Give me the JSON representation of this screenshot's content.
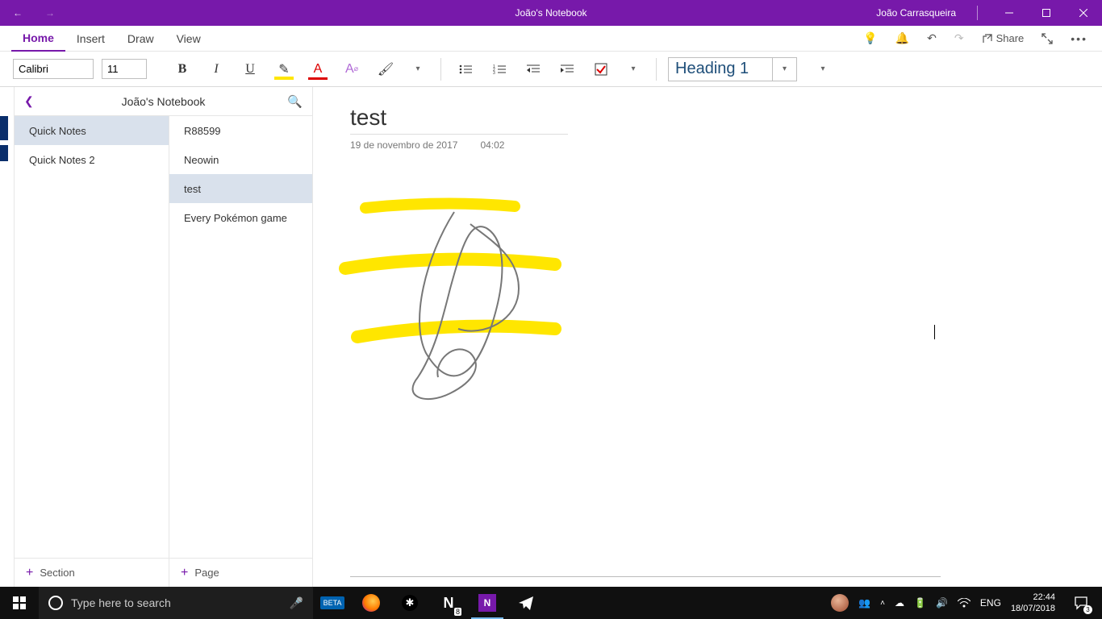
{
  "titlebar": {
    "title": "João's Notebook",
    "user": "João Carrasqueira"
  },
  "menu": {
    "tabs": [
      "Home",
      "Insert",
      "Draw",
      "View"
    ],
    "share": "Share"
  },
  "ribbon": {
    "font": "Calibri",
    "size": "11",
    "style": "Heading 1"
  },
  "notebook": {
    "name": "João's Notebook",
    "sections": [
      {
        "label": "Quick Notes",
        "selected": true
      },
      {
        "label": "Quick Notes 2",
        "selected": false
      }
    ],
    "pages": [
      {
        "label": "R88599",
        "selected": false
      },
      {
        "label": "Neowin",
        "selected": false
      },
      {
        "label": "test",
        "selected": true
      },
      {
        "label": "Every Pokémon game",
        "selected": false
      }
    ],
    "addSection": "Section",
    "addPage": "Page"
  },
  "page": {
    "title": "test",
    "date": "19 de novembro de 2017",
    "time": "04:02"
  },
  "taskbar": {
    "searchPlaceholder": "Type here to search",
    "lang": "ENG",
    "time": "22:44",
    "date": "18/07/2018",
    "notifCount": "3",
    "appBadge": "8"
  }
}
